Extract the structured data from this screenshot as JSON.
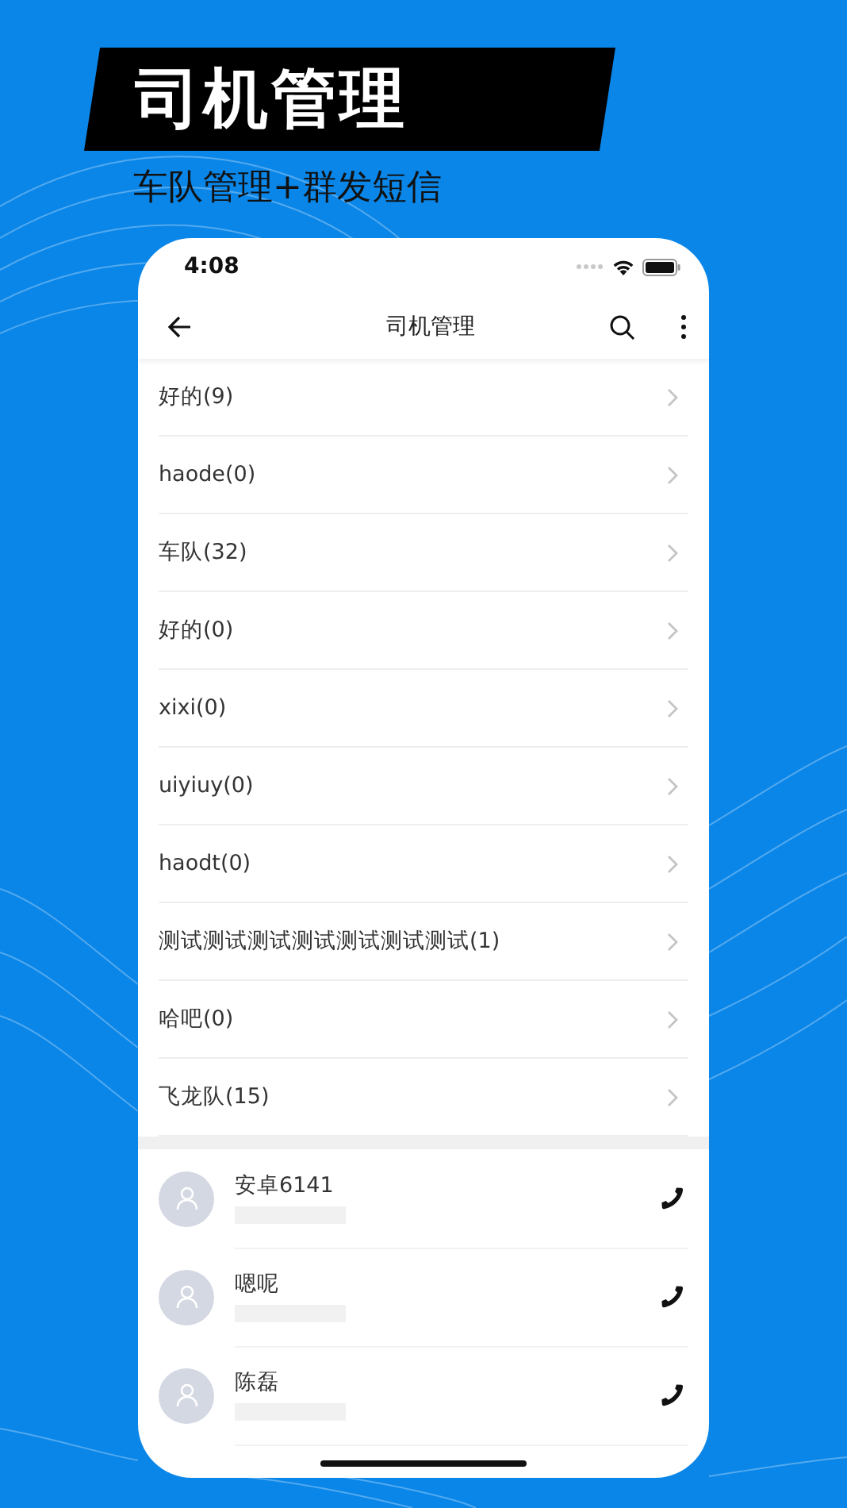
{
  "headline": "司机管理",
  "subtitle": "车队管理+群发短信",
  "status_bar": {
    "time": "4:08"
  },
  "nav_bar": {
    "title": "司机管理"
  },
  "groups": [
    {
      "label": "好的(9)"
    },
    {
      "label": "haode(0)"
    },
    {
      "label": "车队(32)"
    },
    {
      "label": "好的(0)"
    },
    {
      "label": "xixi(0)"
    },
    {
      "label": "uiyiuy(0)"
    },
    {
      "label": "haodt(0)"
    },
    {
      "label": "测试测试测试测试测试测试测试(1)"
    },
    {
      "label": "哈吧(0)"
    },
    {
      "label": "飞龙队(15)"
    }
  ],
  "contacts": [
    {
      "name": "安卓6141"
    },
    {
      "name": "嗯呢"
    },
    {
      "name": "陈磊"
    }
  ]
}
